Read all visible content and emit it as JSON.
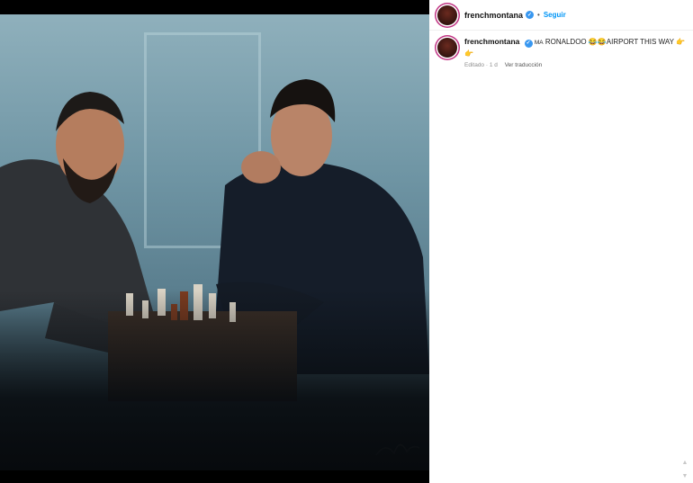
{
  "post": {
    "username": "frenchmontana",
    "follow_label": "Seguir",
    "separator": "•",
    "caption_prefix": "MA",
    "caption_text": "RONALDOO 😂😂AIRPORT THIS WAY 👉",
    "caption_second_line": "👉",
    "edited_label": "Editado",
    "time_ago": "1 d",
    "translate_label": "Ver traducción",
    "meta_separator": "·"
  },
  "scroll": {
    "up": "▲",
    "down": "▼"
  },
  "icons": {
    "verified": "verified-badge-icon"
  },
  "colors": {
    "follow": "#0095f6",
    "verified": "#3897f0"
  }
}
